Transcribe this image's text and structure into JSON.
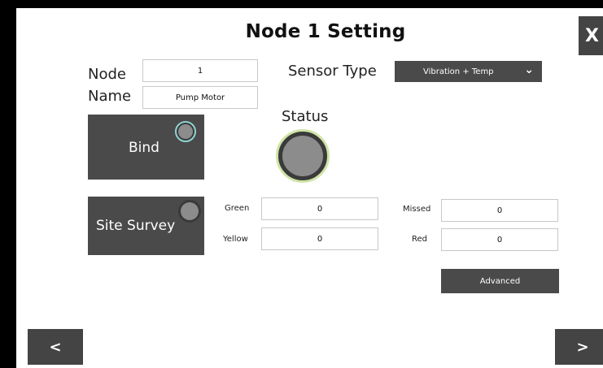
{
  "page": {
    "title": "Node 1 Setting",
    "close_label": "X"
  },
  "node": {
    "label": "Node",
    "value": "1"
  },
  "name": {
    "label": "Name",
    "value": "Pump Motor"
  },
  "sensor": {
    "label": "Sensor Type",
    "selected": "Vibration + Temp"
  },
  "status": {
    "label": "Status"
  },
  "bind": {
    "label": "Bind"
  },
  "survey": {
    "label": "Site Survey",
    "green_label": "Green",
    "green_value": "0",
    "yellow_label": "Yellow",
    "yellow_value": "0",
    "missed_label": "Missed",
    "missed_value": "0",
    "red_label": "Red",
    "red_value": "0"
  },
  "advanced": {
    "label": "Advanced"
  },
  "nav": {
    "prev_label": "<",
    "next_label": ">"
  },
  "colors": {
    "status_ring": "#cfe4a6",
    "bind_ring": "#8fd3cf",
    "button_dark": "#4a4a4a"
  }
}
